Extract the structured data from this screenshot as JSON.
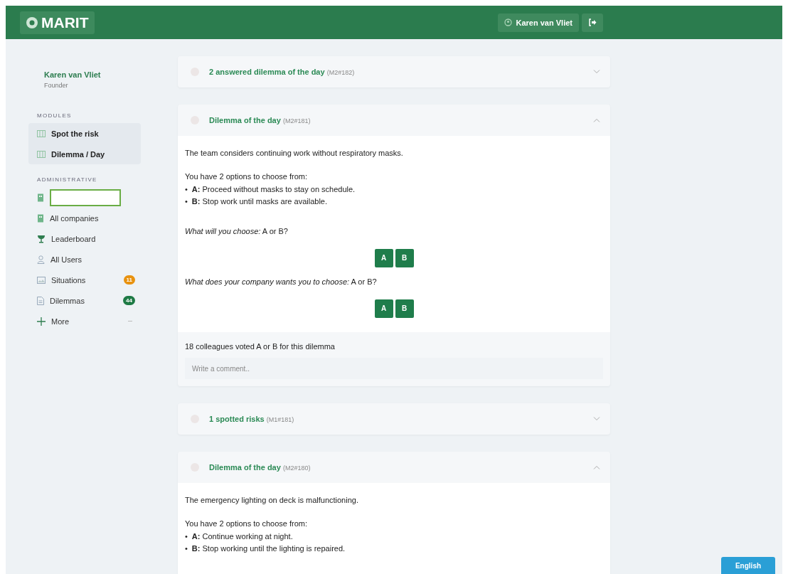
{
  "header": {
    "logo": "MARIT",
    "user_button": "Karen van Vliet"
  },
  "sidebar": {
    "user": {
      "name": "Karen van Vliet",
      "role": "Founder"
    },
    "sections": [
      {
        "title": "MODULES",
        "items": [
          {
            "kind": "module",
            "label": "Spot the risk"
          },
          {
            "kind": "module",
            "label": "Dilemma / Day"
          }
        ]
      },
      {
        "title": "ADMINISTRATIVE",
        "items": [
          {
            "kind": "field"
          },
          {
            "kind": "link",
            "label": "All companies"
          },
          {
            "kind": "link",
            "label": "Leaderboard"
          },
          {
            "kind": "link",
            "label": "All Users"
          },
          {
            "kind": "link",
            "label": "Situations",
            "badge": "11",
            "color": "#e8920f"
          },
          {
            "kind": "link",
            "label": "Dilemmas",
            "badge": "44",
            "color": "#1e7a45"
          },
          {
            "kind": "more",
            "label": "More"
          }
        ]
      }
    ]
  },
  "feed": [
    {
      "title": "2 answered dilemma of the day",
      "ref": "(M2#182)",
      "expanded": false
    },
    {
      "title": "Dilemma of the day",
      "ref": "(M2#181)",
      "expanded": true,
      "situation": "The team considers continuing work without respiratory masks.",
      "options_intro": "You have 2 options to choose from:",
      "options": [
        {
          "marker": "•",
          "text": "**A:** Proceed without masks to stay on schedule."
        },
        {
          "marker": "•",
          "text": "**B:** Stop work until masks are available."
        }
      ],
      "questions": [
        {
          "text": "*What will you choose:* A or B?",
          "buttons": [
            "A",
            "B"
          ]
        },
        {
          "text": "*What does your company wants you to choose:* A or B?",
          "buttons": [
            "A",
            "B"
          ]
        }
      ],
      "votes": "18 colleagues voted A or B for this dilemma",
      "comment_placeholder": "Write a comment.."
    },
    {
      "title": "1 spotted risks",
      "ref": "(M1#181)",
      "expanded": false
    },
    {
      "title": "Dilemma of the day",
      "ref": "(M2#180)",
      "expanded": true,
      "situation": "The emergency lighting on deck is malfunctioning.",
      "options_intro": "You have 2 options to choose from:",
      "options": [
        {
          "marker": "•",
          "text": "**A:** Continue working at night."
        },
        {
          "marker": "•",
          "text": "**B:** Stop working until the lighting is repaired."
        }
      ]
    }
  ],
  "language_button": "English"
}
